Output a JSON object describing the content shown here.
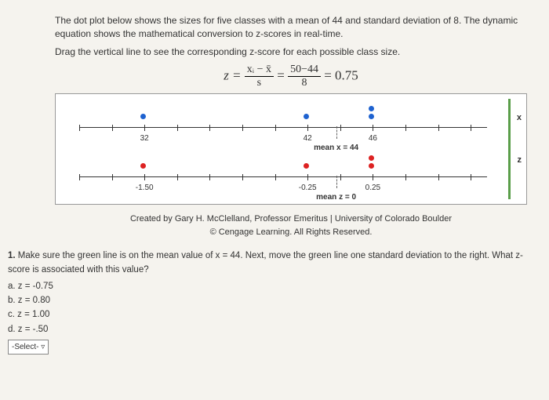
{
  "intro": {
    "p1": "The dot plot below shows the sizes for five classes with a mean of 44 and standard deviation of 8. The dynamic equation shows the mathematical conversion to z-scores in real-time.",
    "p2": "Drag the vertical line to see the corresponding z-score for each possible class size."
  },
  "formula": {
    "z_text": "z =",
    "num1": "xᵢ − x̄",
    "den1": "s",
    "eq": "=",
    "num2": "50−44",
    "den2": "8",
    "result": "= 0.75"
  },
  "plot": {
    "top_labels": {
      "l32": "32",
      "l42": "42",
      "l46": "46",
      "mean": "mean x = 44"
    },
    "bot_labels": {
      "lm150": "-1.50",
      "lm025": "-0.25",
      "l025": "0.25",
      "mean": "mean z = 0"
    },
    "side_x": "x",
    "side_z": "z"
  },
  "attribution": {
    "line1": "Created by Gary H. McClelland, Professor Emeritus | University of Colorado Boulder",
    "line2": "© Cengage Learning. All Rights Reserved."
  },
  "question": {
    "num": "1.",
    "text": "Make sure the green line is on the mean value of x = 44. Next, move the green line one standard deviation to the right. What z-score is associated with this value?",
    "a": "a.  z = -0.75",
    "b": "b.  z = 0.80",
    "c": "c.  z = 1.00",
    "d": "d.  z = -.50",
    "select": "-Select- ▿"
  },
  "chart_data": {
    "type": "dotplot",
    "title": "Class size to z-score conversion",
    "parameters": {
      "mean": 44,
      "sd": 8,
      "current_x": 50,
      "current_z": 0.75
    },
    "x_axis": {
      "label": "x",
      "range": [
        28,
        60
      ],
      "mean_marker": 44
    },
    "z_axis": {
      "label": "z",
      "range": [
        -2,
        2
      ],
      "mean_marker": 0
    },
    "series": [
      {
        "name": "x-values",
        "axis": "x",
        "values": [
          32,
          42,
          46,
          46
        ]
      },
      {
        "name": "z-values",
        "axis": "z",
        "values": [
          -1.5,
          -0.25,
          0.25,
          0.25
        ]
      }
    ]
  }
}
